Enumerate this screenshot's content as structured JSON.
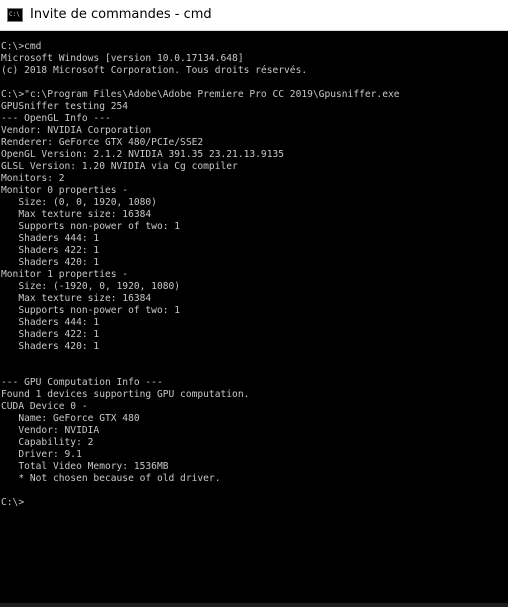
{
  "window": {
    "title": "Invite de commandes - cmd",
    "icon": "cmd-icon",
    "icon_text": "C:\\"
  },
  "console": {
    "lines": [
      "C:\\>cmd",
      "Microsoft Windows [version 10.0.17134.648]",
      "(c) 2018 Microsoft Corporation. Tous droits réservés.",
      "",
      "C:\\>\"c:\\Program Files\\Adobe\\Adobe Premiere Pro CC 2019\\Gpusniffer.exe",
      "GPUSniffer testing 254",
      "--- OpenGL Info ---",
      "Vendor: NVIDIA Corporation",
      "Renderer: GeForce GTX 480/PCIe/SSE2",
      "OpenGL Version: 2.1.2 NVIDIA 391.35 23.21.13.9135",
      "GLSL Version: 1.20 NVIDIA via Cg compiler",
      "Monitors: 2",
      "Monitor 0 properties -",
      "   Size: (0, 0, 1920, 1080)",
      "   Max texture size: 16384",
      "   Supports non-power of two: 1",
      "   Shaders 444: 1",
      "   Shaders 422: 1",
      "   Shaders 420: 1",
      "Monitor 1 properties -",
      "   Size: (-1920, 0, 1920, 1080)",
      "   Max texture size: 16384",
      "   Supports non-power of two: 1",
      "   Shaders 444: 1",
      "   Shaders 422: 1",
      "   Shaders 420: 1",
      "",
      "",
      "--- GPU Computation Info ---",
      "Found 1 devices supporting GPU computation.",
      "CUDA Device 0 -",
      "   Name: GeForce GTX 480",
      "   Vendor: NVIDIA",
      "   Capability: 2",
      "   Driver: 9.1",
      "   Total Video Memory: 1536MB",
      "   * Not chosen because of old driver.",
      "",
      "C:\\>"
    ]
  },
  "colors": {
    "background": "#000000",
    "text": "#c8c8c8",
    "titlebar": "#ffffff"
  }
}
